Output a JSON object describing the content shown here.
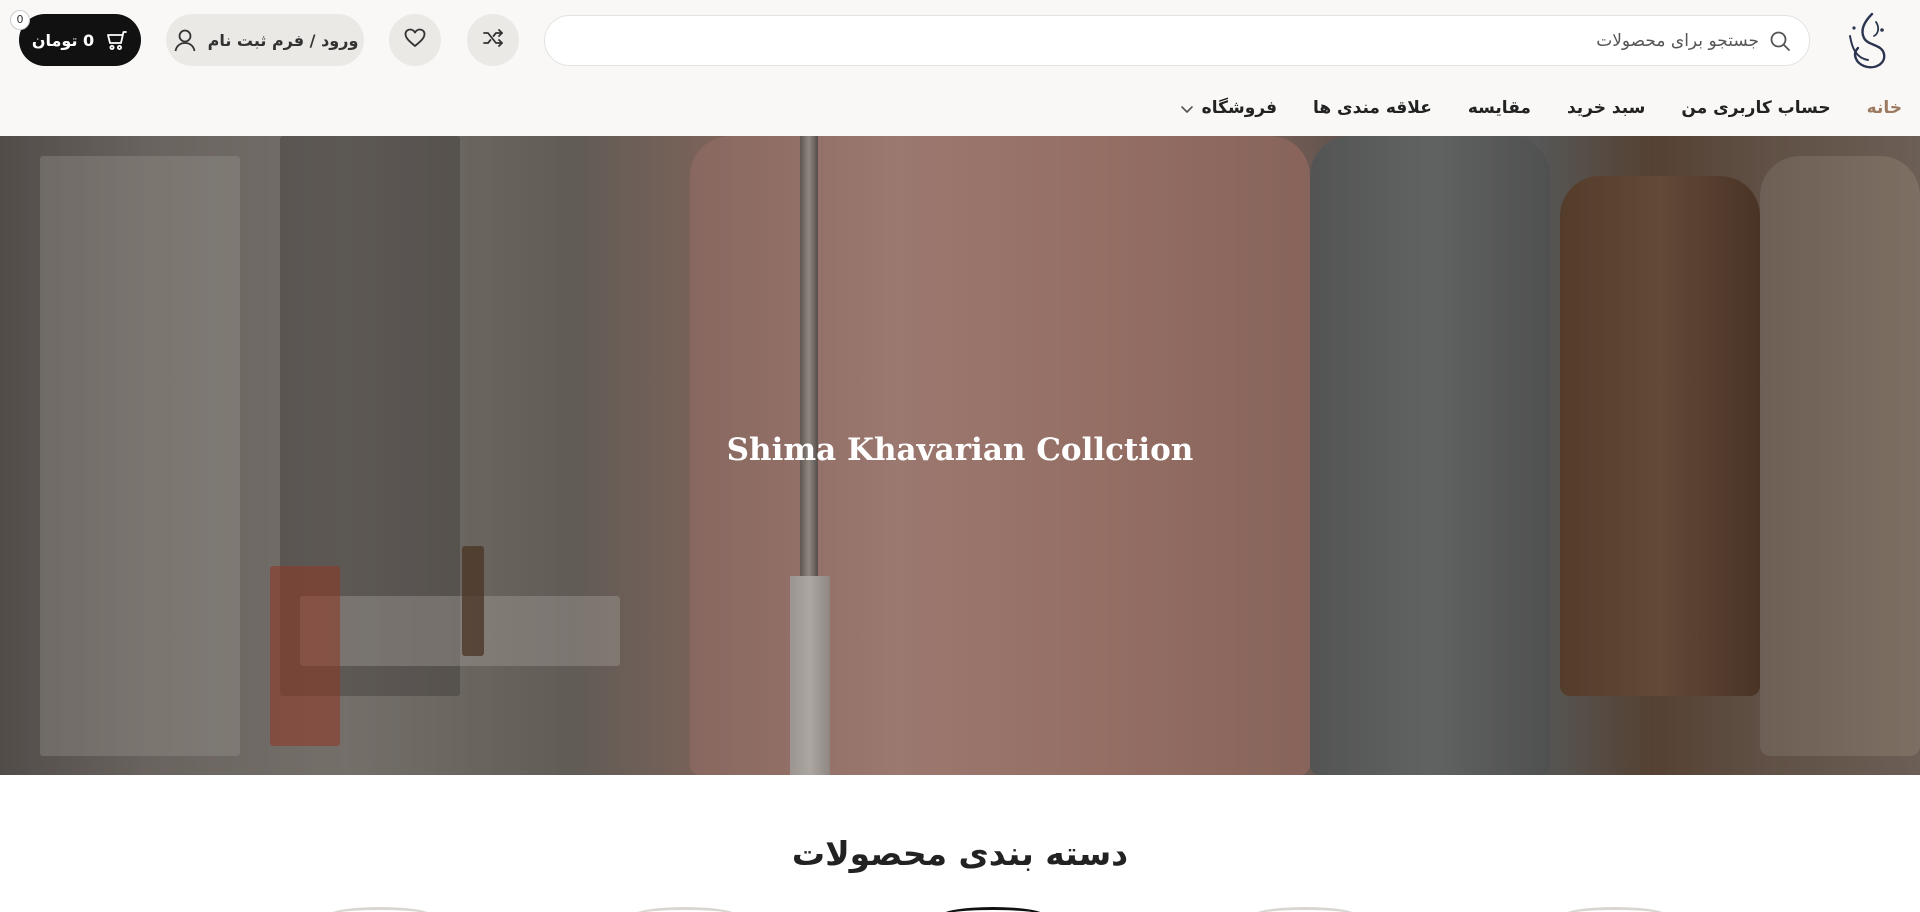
{
  "header": {
    "logo": "calligraphy-logo",
    "search": {
      "placeholder": "جستجو برای محصولات",
      "icon": "search-icon"
    },
    "compare_icon": "shuffle-icon",
    "wishlist_icon": "heart-icon",
    "login": {
      "label": "ورود / فرم ثبت نام",
      "icon": "user-icon"
    },
    "cart": {
      "label": "0 تومان",
      "count": "0",
      "icon": "cart-icon"
    }
  },
  "nav": {
    "items": [
      {
        "label": "خانه",
        "active": true
      },
      {
        "label": "حساب کاربری من"
      },
      {
        "label": "سبد خرید"
      },
      {
        "label": "مقایسه"
      },
      {
        "label": "علاقه مندی ها"
      },
      {
        "label": "فروشگاه",
        "has_dropdown": true
      }
    ]
  },
  "hero": {
    "title": "Shima Khavarian Collction"
  },
  "categories": {
    "title": "دسته بندی محصولات"
  },
  "colors": {
    "accent": "#9d7a5f",
    "dark": "#111111",
    "header_bg": "#f9f8f6"
  }
}
